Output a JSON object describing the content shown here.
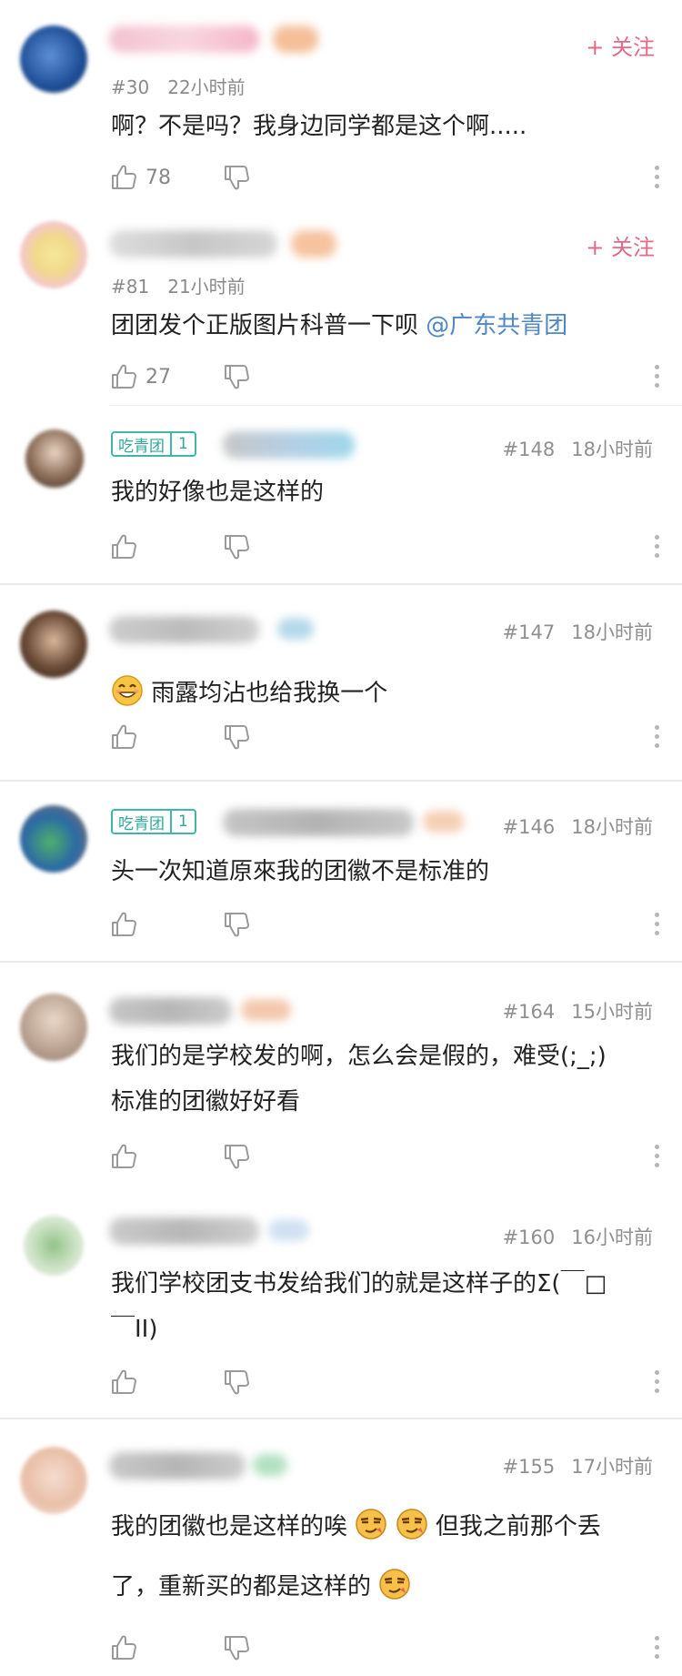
{
  "follow_label": "+ 关注",
  "comments": [
    {
      "floor": "#30",
      "time": "22小时前",
      "text": "啊？不是吗？我身边同学都是这个啊.....",
      "likes": "78"
    },
    {
      "floor": "#81",
      "time": "21小时前",
      "text": "团团发个正版图片科普一下呗 ",
      "mention": "@广东共青团",
      "likes": "27"
    },
    {
      "badge_name": "吃青团",
      "badge_level": "1",
      "floor": "#148",
      "time": "18小时前",
      "text": "我的好像也是这样的"
    },
    {
      "floor": "#147",
      "time": "18小时前",
      "text": "雨露均沾也给我换一个"
    },
    {
      "badge_name": "吃青团",
      "badge_level": "1",
      "floor": "#146",
      "time": "18小时前",
      "text": "头一次知道原來我的团徽不是标准的"
    },
    {
      "floor": "#164",
      "time": "15小时前",
      "text_line1": "我们的是学校发的啊，怎么会是假的，难受(;_;)",
      "text_line2": "标准的团徽好好看"
    },
    {
      "floor": "#160",
      "time": "16小时前",
      "text_line1": "我们学校团支书发给我们的就是这样子的Σ(￣□",
      "text_line2": "￣II)"
    },
    {
      "floor": "#155",
      "time": "17小时前",
      "text_part1": "我的团徽也是这样的唉",
      "text_part2": "但我之前那个丢",
      "text_part3": "了，重新买的都是这样的"
    }
  ],
  "colors": {
    "follow": "#e26a87",
    "badge": "#3fb6a8",
    "mention": "#4e87c4",
    "meta": "#8a8a8a"
  },
  "icons": [
    "thumbs-up-icon",
    "thumbs-down-icon",
    "more-vertical-icon",
    "smile-emoji-icon",
    "sly-emoji-icon"
  ]
}
